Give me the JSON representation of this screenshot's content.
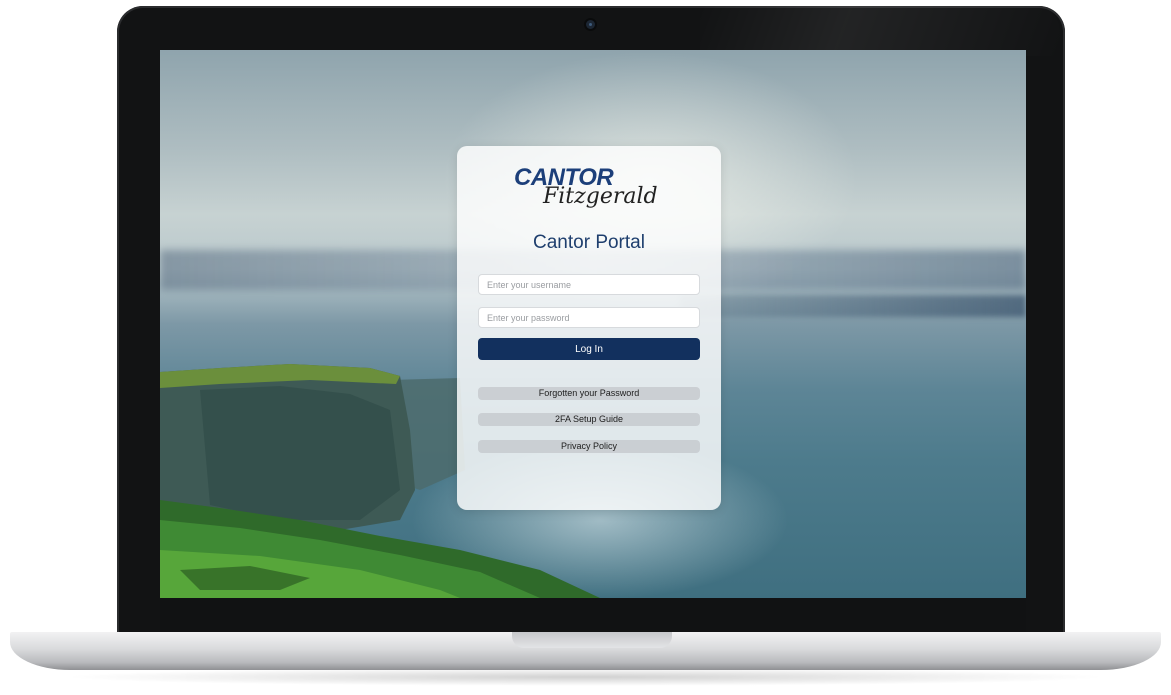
{
  "brand": {
    "logo_top": "CANTOR",
    "logo_bottom": "Fitzgerald"
  },
  "login": {
    "title": "Cantor Portal",
    "username_placeholder": "Enter your username",
    "password_placeholder": "Enter your password",
    "login_label": "Log In"
  },
  "links": {
    "forgot_password": "Forgotten your Password",
    "setup_2fa": "2FA Setup Guide",
    "privacy_policy": "Privacy Policy"
  },
  "colors": {
    "brand_navy": "#12305e",
    "title_blue": "#1f3f6e",
    "logo_blue": "#1c3f7a"
  }
}
